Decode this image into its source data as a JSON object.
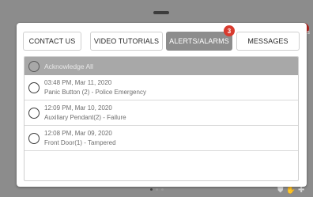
{
  "tabs": [
    {
      "label": "CONTACT US"
    },
    {
      "label": "VIDEO TUTORIALS"
    },
    {
      "label": "ALERTS/ALARMS",
      "badge": "3"
    },
    {
      "label": "MESSAGES"
    }
  ],
  "acknowledge_all_label": "Acknowledge All",
  "alerts": [
    {
      "time": "03:48 PM, Mar 11, 2020",
      "description": "Panic Button (2) - Police Emergency"
    },
    {
      "time": "12:09 PM, Mar 10, 2020",
      "description": "Auxiliary Pendant(2) - Failure"
    },
    {
      "time": "12:08 PM, Mar 09, 2020",
      "description": "Front Door(1) - Tampered"
    }
  ],
  "background": {
    "right_fragment": "rs"
  },
  "icons": {
    "shield": "shield-icon",
    "hand": "hand-icon",
    "medical": "medical-cross-icon"
  },
  "colors": {
    "active_tab": "#8d8d8d",
    "badge": "#d93b2f",
    "acknowledge_row": "#a8a8a8"
  }
}
